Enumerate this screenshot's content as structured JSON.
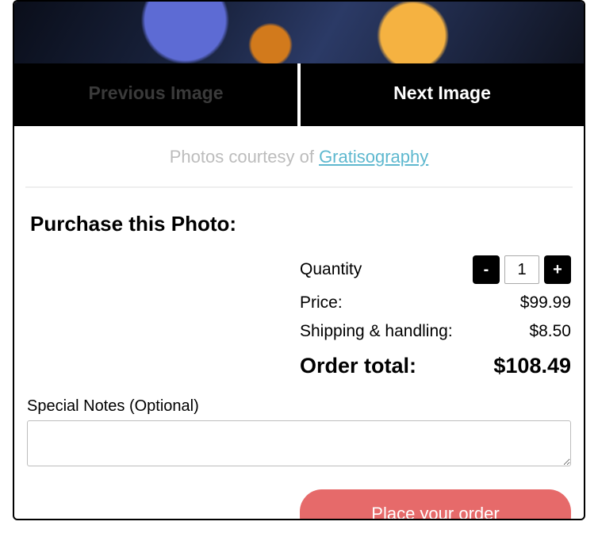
{
  "nav": {
    "prev_label": "Previous Image",
    "next_label": "Next Image"
  },
  "credit": {
    "prefix": "Photos courtesy of ",
    "link_text": "Gratisography"
  },
  "purchase": {
    "heading": "Purchase this Photo:",
    "quantity_label": "Quantity",
    "quantity_value": "1",
    "minus_label": "-",
    "plus_label": "+",
    "price_label": "Price:",
    "price_value": "$99.99",
    "shipping_label": "Shipping & handling:",
    "shipping_value": "$8.50",
    "total_label": "Order total:",
    "total_value": "$108.49"
  },
  "notes": {
    "label": "Special Notes (Optional)",
    "value": ""
  },
  "submit": {
    "label": "Place your order"
  }
}
